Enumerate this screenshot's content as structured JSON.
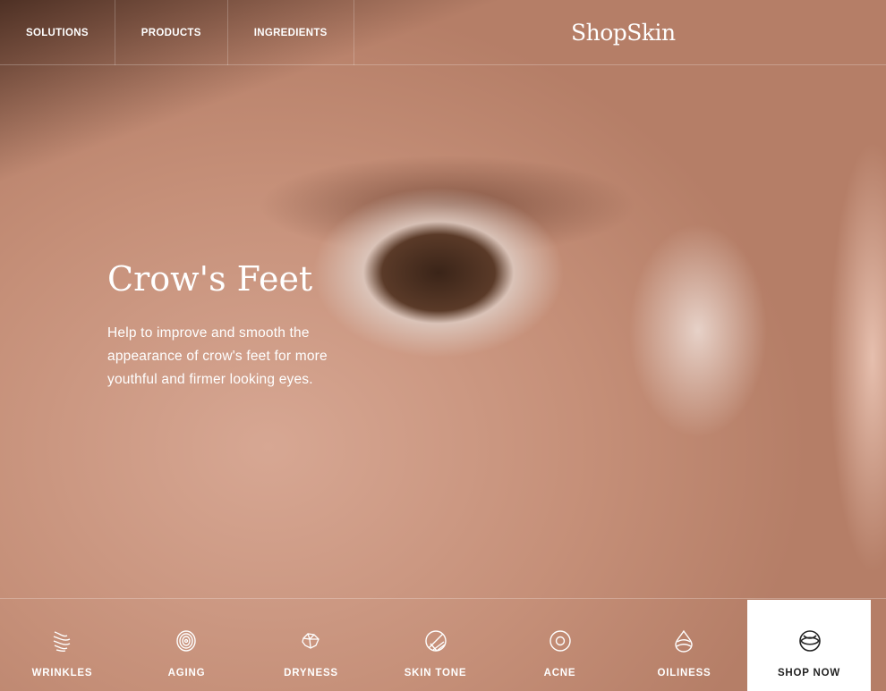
{
  "nav": {
    "items": [
      {
        "label": "SOLUTIONS"
      },
      {
        "label": "PRODUCTS"
      },
      {
        "label": "INGREDIENTS"
      }
    ],
    "logo": "ShopSkin"
  },
  "hero": {
    "title": "Crow's Feet",
    "description": "Help to improve and smooth the appearance of crow's feet for more youthful and firmer looking eyes."
  },
  "categories": [
    {
      "label": "WRINKLES",
      "icon": "wrinkles-icon"
    },
    {
      "label": "AGING",
      "icon": "aging-icon"
    },
    {
      "label": "DRYNESS",
      "icon": "dryness-icon"
    },
    {
      "label": "SKIN TONE",
      "icon": "skin-tone-icon"
    },
    {
      "label": "ACNE",
      "icon": "acne-icon"
    },
    {
      "label": "OILINESS",
      "icon": "oiliness-icon"
    }
  ],
  "shop_now": {
    "label": "SHOP NOW",
    "icon": "shop-icon"
  }
}
